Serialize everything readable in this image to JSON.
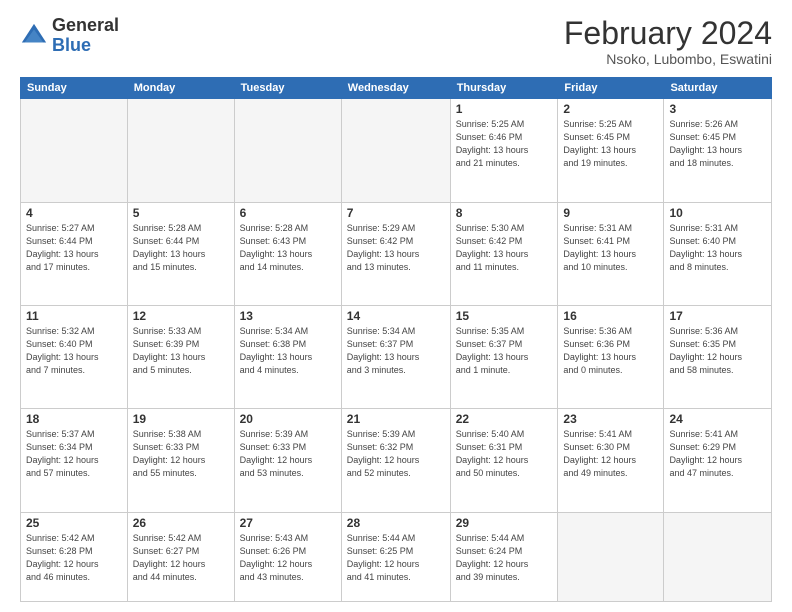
{
  "logo": {
    "general": "General",
    "blue": "Blue"
  },
  "header": {
    "month": "February 2024",
    "location": "Nsoko, Lubombo, Eswatini"
  },
  "days_of_week": [
    "Sunday",
    "Monday",
    "Tuesday",
    "Wednesday",
    "Thursday",
    "Friday",
    "Saturday"
  ],
  "weeks": [
    [
      {
        "day": "",
        "detail": ""
      },
      {
        "day": "",
        "detail": ""
      },
      {
        "day": "",
        "detail": ""
      },
      {
        "day": "",
        "detail": ""
      },
      {
        "day": "1",
        "detail": "Sunrise: 5:25 AM\nSunset: 6:46 PM\nDaylight: 13 hours\nand 21 minutes."
      },
      {
        "day": "2",
        "detail": "Sunrise: 5:25 AM\nSunset: 6:45 PM\nDaylight: 13 hours\nand 19 minutes."
      },
      {
        "day": "3",
        "detail": "Sunrise: 5:26 AM\nSunset: 6:45 PM\nDaylight: 13 hours\nand 18 minutes."
      }
    ],
    [
      {
        "day": "4",
        "detail": "Sunrise: 5:27 AM\nSunset: 6:44 PM\nDaylight: 13 hours\nand 17 minutes."
      },
      {
        "day": "5",
        "detail": "Sunrise: 5:28 AM\nSunset: 6:44 PM\nDaylight: 13 hours\nand 15 minutes."
      },
      {
        "day": "6",
        "detail": "Sunrise: 5:28 AM\nSunset: 6:43 PM\nDaylight: 13 hours\nand 14 minutes."
      },
      {
        "day": "7",
        "detail": "Sunrise: 5:29 AM\nSunset: 6:42 PM\nDaylight: 13 hours\nand 13 minutes."
      },
      {
        "day": "8",
        "detail": "Sunrise: 5:30 AM\nSunset: 6:42 PM\nDaylight: 13 hours\nand 11 minutes."
      },
      {
        "day": "9",
        "detail": "Sunrise: 5:31 AM\nSunset: 6:41 PM\nDaylight: 13 hours\nand 10 minutes."
      },
      {
        "day": "10",
        "detail": "Sunrise: 5:31 AM\nSunset: 6:40 PM\nDaylight: 13 hours\nand 8 minutes."
      }
    ],
    [
      {
        "day": "11",
        "detail": "Sunrise: 5:32 AM\nSunset: 6:40 PM\nDaylight: 13 hours\nand 7 minutes."
      },
      {
        "day": "12",
        "detail": "Sunrise: 5:33 AM\nSunset: 6:39 PM\nDaylight: 13 hours\nand 5 minutes."
      },
      {
        "day": "13",
        "detail": "Sunrise: 5:34 AM\nSunset: 6:38 PM\nDaylight: 13 hours\nand 4 minutes."
      },
      {
        "day": "14",
        "detail": "Sunrise: 5:34 AM\nSunset: 6:37 PM\nDaylight: 13 hours\nand 3 minutes."
      },
      {
        "day": "15",
        "detail": "Sunrise: 5:35 AM\nSunset: 6:37 PM\nDaylight: 13 hours\nand 1 minute."
      },
      {
        "day": "16",
        "detail": "Sunrise: 5:36 AM\nSunset: 6:36 PM\nDaylight: 13 hours\nand 0 minutes."
      },
      {
        "day": "17",
        "detail": "Sunrise: 5:36 AM\nSunset: 6:35 PM\nDaylight: 12 hours\nand 58 minutes."
      }
    ],
    [
      {
        "day": "18",
        "detail": "Sunrise: 5:37 AM\nSunset: 6:34 PM\nDaylight: 12 hours\nand 57 minutes."
      },
      {
        "day": "19",
        "detail": "Sunrise: 5:38 AM\nSunset: 6:33 PM\nDaylight: 12 hours\nand 55 minutes."
      },
      {
        "day": "20",
        "detail": "Sunrise: 5:39 AM\nSunset: 6:33 PM\nDaylight: 12 hours\nand 53 minutes."
      },
      {
        "day": "21",
        "detail": "Sunrise: 5:39 AM\nSunset: 6:32 PM\nDaylight: 12 hours\nand 52 minutes."
      },
      {
        "day": "22",
        "detail": "Sunrise: 5:40 AM\nSunset: 6:31 PM\nDaylight: 12 hours\nand 50 minutes."
      },
      {
        "day": "23",
        "detail": "Sunrise: 5:41 AM\nSunset: 6:30 PM\nDaylight: 12 hours\nand 49 minutes."
      },
      {
        "day": "24",
        "detail": "Sunrise: 5:41 AM\nSunset: 6:29 PM\nDaylight: 12 hours\nand 47 minutes."
      }
    ],
    [
      {
        "day": "25",
        "detail": "Sunrise: 5:42 AM\nSunset: 6:28 PM\nDaylight: 12 hours\nand 46 minutes."
      },
      {
        "day": "26",
        "detail": "Sunrise: 5:42 AM\nSunset: 6:27 PM\nDaylight: 12 hours\nand 44 minutes."
      },
      {
        "day": "27",
        "detail": "Sunrise: 5:43 AM\nSunset: 6:26 PM\nDaylight: 12 hours\nand 43 minutes."
      },
      {
        "day": "28",
        "detail": "Sunrise: 5:44 AM\nSunset: 6:25 PM\nDaylight: 12 hours\nand 41 minutes."
      },
      {
        "day": "29",
        "detail": "Sunrise: 5:44 AM\nSunset: 6:24 PM\nDaylight: 12 hours\nand 39 minutes."
      },
      {
        "day": "",
        "detail": ""
      },
      {
        "day": "",
        "detail": ""
      }
    ]
  ],
  "colors": {
    "header_bg": "#2e6db4",
    "border": "#cccccc",
    "empty_bg": "#f5f5f5"
  }
}
